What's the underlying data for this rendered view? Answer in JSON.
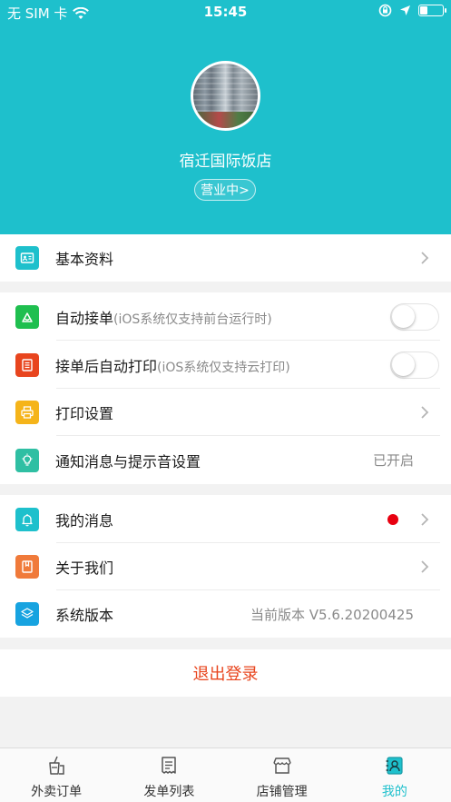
{
  "status_bar": {
    "carrier": "无 SIM 卡",
    "time": "15:45"
  },
  "profile": {
    "shop_name": "宿迁国际饭店",
    "status_label": "营业中>"
  },
  "section1": {
    "basic_info": "基本资料"
  },
  "section2": {
    "auto_accept": {
      "label": "自动接单",
      "note": "(iOS系统仅支持前台运行时)",
      "enabled": false
    },
    "auto_print": {
      "label": "接单后自动打印",
      "note": "(iOS系统仅支持云打印)",
      "enabled": false
    },
    "print_settings": "打印设置",
    "notify_settings": {
      "label": "通知消息与提示音设置",
      "value": "已开启"
    }
  },
  "section3": {
    "my_messages": "我的消息",
    "about_us": "关于我们",
    "system_version": {
      "label": "系统版本",
      "value": "当前版本 V5.6.20200425"
    }
  },
  "logout_label": "退出登录",
  "tabs": [
    {
      "label": "外卖订单",
      "icon": "drink-icon",
      "active": false
    },
    {
      "label": "发单列表",
      "icon": "receipt-icon",
      "active": false
    },
    {
      "label": "店铺管理",
      "icon": "store-icon",
      "active": false
    },
    {
      "label": "我的",
      "icon": "profile-card-icon",
      "active": true
    }
  ],
  "colors": {
    "accent": "#1ec0cc",
    "logout": "#e8451e",
    "badge": "#e80010"
  }
}
